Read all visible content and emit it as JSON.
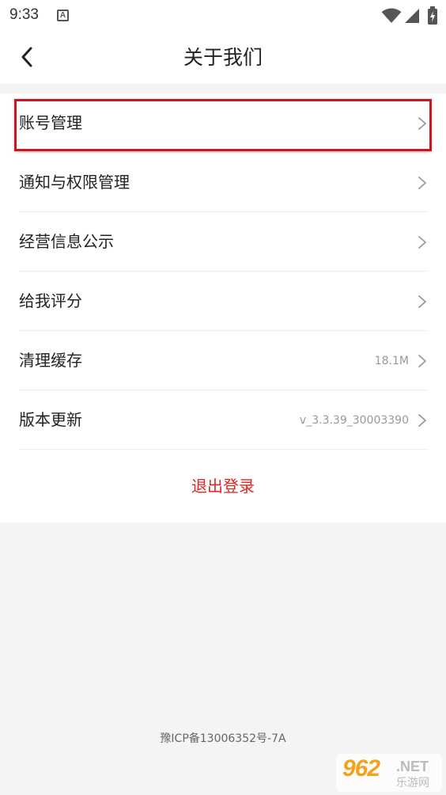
{
  "status_bar": {
    "time": "9:33",
    "notification_icon": "A"
  },
  "header": {
    "title": "关于我们"
  },
  "menu": {
    "items": [
      {
        "label": "账号管理",
        "value": ""
      },
      {
        "label": "通知与权限管理",
        "value": ""
      },
      {
        "label": "经营信息公示",
        "value": ""
      },
      {
        "label": "给我评分",
        "value": ""
      },
      {
        "label": "清理缓存",
        "value": "18.1M"
      },
      {
        "label": "版本更新",
        "value": "v_3.3.39_30003390"
      }
    ],
    "logout_label": "退出登录"
  },
  "footer": {
    "icp": "豫ICP备13006352号-7A"
  },
  "watermark": {
    "number": "962",
    "suffix": ".NET",
    "name": "乐游网"
  },
  "colors": {
    "accent_red": "#e02424",
    "highlight_border": "#d0131e",
    "background": "#f4f4f4"
  }
}
